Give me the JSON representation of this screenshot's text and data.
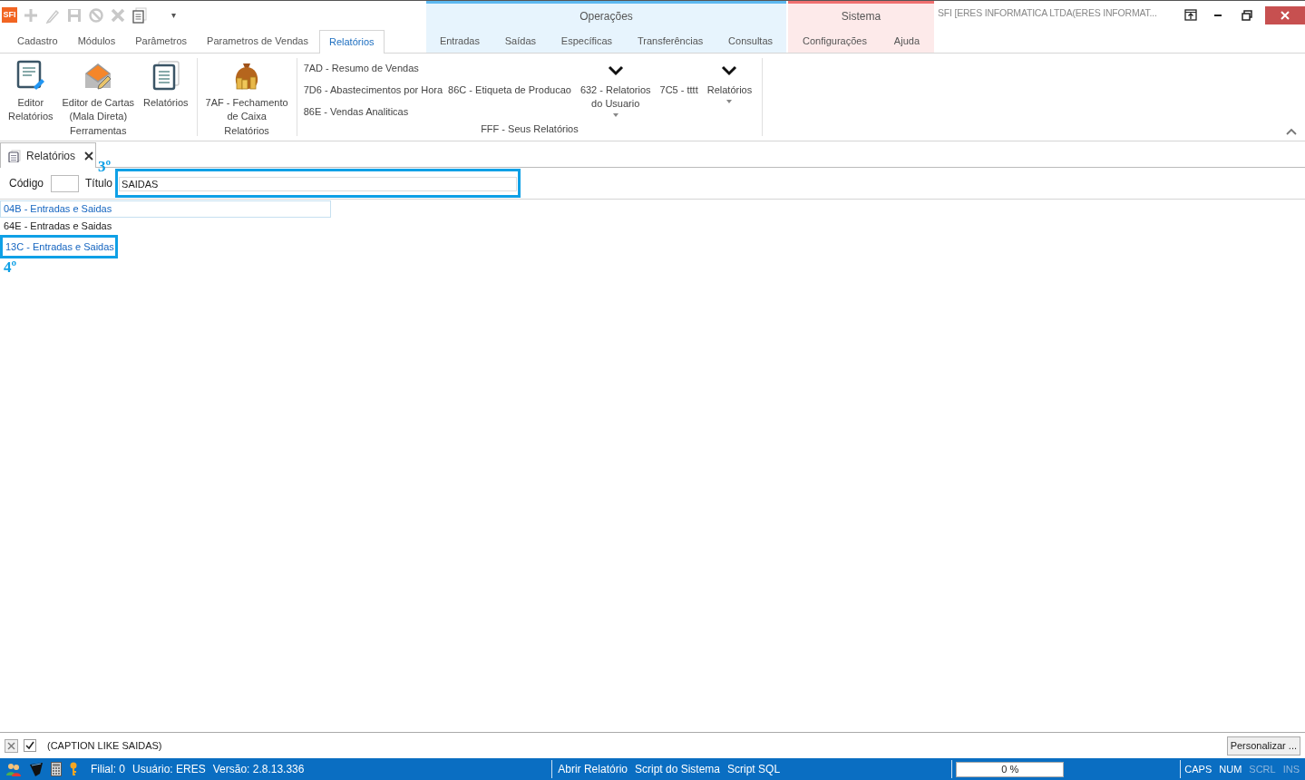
{
  "quick_access": {
    "logo": "SFI",
    "dropdown": "▾"
  },
  "window": {
    "title": "SFI [ERES INFORMATICA LTDA(ERES INFORMAT..."
  },
  "tabs": [
    {
      "label": "Cadastro",
      "selected": false
    },
    {
      "label": "Módulos",
      "selected": false
    },
    {
      "label": "Parâmetros",
      "selected": false
    },
    {
      "label": "Parametros de Vendas",
      "selected": false
    },
    {
      "label": "Relatórios",
      "selected": true
    }
  ],
  "context_groups": [
    {
      "title": "Operações",
      "color": "#5cb8f0",
      "tabs": [
        {
          "label": "Entradas",
          "selected": false
        },
        {
          "label": "Saídas",
          "selected": false
        },
        {
          "label": "Específicas",
          "selected": false
        },
        {
          "label": "Transferências",
          "selected": false
        },
        {
          "label": "Consultas",
          "selected": false
        }
      ]
    },
    {
      "title": "Sistema",
      "color": "#f07070",
      "tabs": [
        {
          "label": "Configurações",
          "selected": false
        },
        {
          "label": "Ajuda",
          "selected": false
        }
      ]
    }
  ],
  "ribbon": {
    "groups": [
      {
        "label": "Ferramentas",
        "columns": [
          {
            "kind": "large",
            "label": "Editor\nRelatórios"
          },
          {
            "kind": "large",
            "label": "Editor de Cartas\n(Mala Direta)"
          },
          {
            "kind": "large",
            "label": "Relatórios"
          }
        ]
      },
      {
        "label": "Relatórios",
        "columns": [
          {
            "kind": "large",
            "label": "7AF - Fechamento\nde Caixa"
          }
        ]
      },
      {
        "label": "FFF - Seus Relatórios",
        "columns": [
          {
            "kind": "small",
            "items": [
              "7AD - Resumo de Vendas",
              "7D6 - Abastecimentos por Hora",
              "86E - Vendas Analiticas"
            ]
          },
          {
            "kind": "small",
            "items": [
              "86C - Etiqueta de Producao"
            ]
          },
          {
            "kind": "dropdown",
            "label": "632 - Relatorios\ndo Usuario"
          },
          {
            "kind": "small",
            "items": [
              "7C5 - tttt"
            ]
          },
          {
            "kind": "dropdown",
            "label": "Relatórios"
          }
        ]
      }
    ]
  },
  "document_tab": {
    "label": "Relatórios"
  },
  "filter": {
    "code_label": "Código",
    "title_label": "Título",
    "title_value": "SAIDAS",
    "annotation": "3º"
  },
  "rows": [
    {
      "text": "04B - Entradas e Saidas",
      "selected": true,
      "hot": false
    },
    {
      "text": "64E - Entradas e Saidas",
      "selected": false,
      "hot": false
    },
    {
      "text": "13C - Entradas e Saidas",
      "selected": false,
      "hot": true,
      "annotation": "4º"
    }
  ],
  "filter_bar": {
    "checked": true,
    "expression": "(CAPTION LIKE SAIDAS)",
    "button": "Personalizar ..."
  },
  "status_bar": {
    "info": [
      "Filial: 0",
      "Usuário: ERES",
      "Versão: 2.8.13.336"
    ],
    "actions": [
      "Abrir Relatório",
      "Script do Sistema",
      "Script SQL"
    ],
    "progress": {
      "level": 0,
      "reading": "0 %"
    },
    "keys": [
      {
        "label": "CAPS",
        "on": true
      },
      {
        "label": "NUM",
        "on": true
      },
      {
        "label": "SCRL",
        "on": false
      },
      {
        "label": "INS",
        "on": false
      }
    ]
  }
}
